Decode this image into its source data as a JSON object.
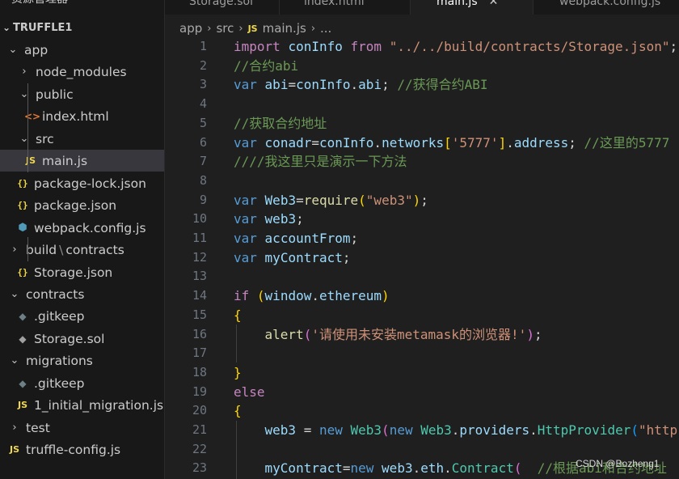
{
  "sidebar": {
    "title": "资源管理器",
    "project": "TRUFFLE1",
    "items": [
      {
        "label": "app",
        "kind": "folder-open"
      },
      {
        "label": "node_modules",
        "kind": "folder-closed"
      },
      {
        "label": "public",
        "kind": "folder-open"
      },
      {
        "label": "index.html",
        "kind": "html"
      },
      {
        "label": "src",
        "kind": "folder-open"
      },
      {
        "label": "main.js",
        "kind": "js"
      },
      {
        "label": "package-lock.json",
        "kind": "json"
      },
      {
        "label": "package.json",
        "kind": "json"
      },
      {
        "label": "webpack.config.js",
        "kind": "webpack"
      },
      {
        "label": "build",
        "label2": "contracts",
        "kind": "folder-closed"
      },
      {
        "label": "Storage.json",
        "kind": "json"
      },
      {
        "label": "contracts",
        "kind": "folder-open"
      },
      {
        "label": ".gitkeep",
        "kind": "git"
      },
      {
        "label": "Storage.sol",
        "kind": "sol"
      },
      {
        "label": "migrations",
        "kind": "folder-open"
      },
      {
        "label": ".gitkeep",
        "kind": "git"
      },
      {
        "label": "1_initial_migration.js",
        "kind": "js"
      },
      {
        "label": "test",
        "kind": "folder-closed"
      },
      {
        "label": "truffle-config.js",
        "kind": "js"
      }
    ]
  },
  "tabs": [
    {
      "label": "Storage.sol"
    },
    {
      "label": "index.html"
    },
    {
      "label": "main.js",
      "active": true,
      "close": "✕"
    },
    {
      "label": "webpack.config.js"
    }
  ],
  "breadcrumb": {
    "parts": [
      "app",
      "src"
    ],
    "file": "main.js",
    "tail": "..."
  },
  "editor": {
    "lines": [
      {
        "n": "1",
        "t": [
          [
            "kw2",
            "import"
          ],
          [
            "pl",
            " "
          ],
          [
            "vr",
            "conInfo"
          ],
          [
            "pl",
            " "
          ],
          [
            "kw2",
            "from"
          ],
          [
            "pl",
            " "
          ],
          [
            "str",
            "\"../../build/contracts/Storage.json\""
          ],
          [
            "pl",
            ";"
          ]
        ]
      },
      {
        "n": "2",
        "t": [
          [
            "cm",
            "//合约abi"
          ]
        ]
      },
      {
        "n": "3",
        "t": [
          [
            "kw",
            "var"
          ],
          [
            "pl",
            " "
          ],
          [
            "vr",
            "abi"
          ],
          [
            "pl",
            "="
          ],
          [
            "vr",
            "conInfo"
          ],
          [
            "pl",
            "."
          ],
          [
            "vr",
            "abi"
          ],
          [
            "pl",
            "; "
          ],
          [
            "cm",
            "//获得合约ABI"
          ]
        ]
      },
      {
        "n": "4",
        "t": []
      },
      {
        "n": "5",
        "t": [
          [
            "cm",
            "//获取合约地址"
          ]
        ]
      },
      {
        "n": "6",
        "t": [
          [
            "kw",
            "var"
          ],
          [
            "pl",
            " "
          ],
          [
            "vr",
            "conadr"
          ],
          [
            "pl",
            "="
          ],
          [
            "vr",
            "conInfo"
          ],
          [
            "pl",
            "."
          ],
          [
            "vr",
            "networks"
          ],
          [
            "br1",
            "["
          ],
          [
            "str",
            "'5777'"
          ],
          [
            "br1",
            "]"
          ],
          [
            "pl",
            "."
          ],
          [
            "vr",
            "address"
          ],
          [
            "pl",
            "; "
          ],
          [
            "cm",
            "//这里的5777"
          ]
        ]
      },
      {
        "n": "7",
        "t": [
          [
            "cm",
            "////我这里只是演示一下方法"
          ]
        ]
      },
      {
        "n": "8",
        "t": []
      },
      {
        "n": "9",
        "t": [
          [
            "kw",
            "var"
          ],
          [
            "pl",
            " "
          ],
          [
            "vr",
            "Web3"
          ],
          [
            "pl",
            "="
          ],
          [
            "fn",
            "require"
          ],
          [
            "br1",
            "("
          ],
          [
            "str",
            "\"web3\""
          ],
          [
            "br1",
            ")"
          ],
          [
            "pl",
            ";"
          ]
        ]
      },
      {
        "n": "10",
        "t": [
          [
            "kw",
            "var"
          ],
          [
            "pl",
            " "
          ],
          [
            "vr",
            "web3"
          ],
          [
            "pl",
            ";"
          ]
        ]
      },
      {
        "n": "11",
        "t": [
          [
            "kw",
            "var"
          ],
          [
            "pl",
            " "
          ],
          [
            "vr",
            "accountFrom"
          ],
          [
            "pl",
            ";"
          ]
        ]
      },
      {
        "n": "12",
        "t": [
          [
            "kw",
            "var"
          ],
          [
            "pl",
            " "
          ],
          [
            "vr",
            "myContract"
          ],
          [
            "pl",
            ";"
          ]
        ]
      },
      {
        "n": "13",
        "t": []
      },
      {
        "n": "14",
        "t": [
          [
            "kw2",
            "if"
          ],
          [
            "pl",
            " "
          ],
          [
            "br1",
            "("
          ],
          [
            "vr",
            "window"
          ],
          [
            "pl",
            "."
          ],
          [
            "vr",
            "ethereum"
          ],
          [
            "br1",
            ")"
          ]
        ]
      },
      {
        "n": "15",
        "t": [
          [
            "br1",
            "{"
          ]
        ]
      },
      {
        "n": "16",
        "t": [
          [
            "pl",
            "    "
          ],
          [
            "fn",
            "alert"
          ],
          [
            "br2",
            "("
          ],
          [
            "str",
            "'请使用未安装metamask的浏览器!'"
          ],
          [
            "br2",
            ")"
          ],
          [
            "pl",
            ";"
          ]
        ]
      },
      {
        "n": "17",
        "t": []
      },
      {
        "n": "18",
        "t": [
          [
            "br1",
            "}"
          ]
        ]
      },
      {
        "n": "19",
        "t": [
          [
            "kw2",
            "else"
          ]
        ]
      },
      {
        "n": "20",
        "t": [
          [
            "br1",
            "{"
          ]
        ]
      },
      {
        "n": "21",
        "t": [
          [
            "pl",
            "    "
          ],
          [
            "vr",
            "web3"
          ],
          [
            "pl",
            " = "
          ],
          [
            "kw",
            "new"
          ],
          [
            "pl",
            " "
          ],
          [
            "cl",
            "Web3"
          ],
          [
            "br2",
            "("
          ],
          [
            "kw",
            "new"
          ],
          [
            "pl",
            " "
          ],
          [
            "cl",
            "Web3"
          ],
          [
            "pl",
            "."
          ],
          [
            "vr",
            "providers"
          ],
          [
            "pl",
            "."
          ],
          [
            "cl",
            "HttpProvider"
          ],
          [
            "br3",
            "("
          ],
          [
            "str",
            "\"http"
          ]
        ]
      },
      {
        "n": "22",
        "t": []
      },
      {
        "n": "23",
        "t": [
          [
            "pl",
            "    "
          ],
          [
            "vr",
            "myContract"
          ],
          [
            "pl",
            "="
          ],
          [
            "kw",
            "new"
          ],
          [
            "pl",
            " "
          ],
          [
            "vr",
            "web3"
          ],
          [
            "pl",
            "."
          ],
          [
            "vr",
            "eth"
          ],
          [
            "pl",
            "."
          ],
          [
            "cl",
            "Contract"
          ],
          [
            "br2",
            "("
          ],
          [
            "pl",
            "  "
          ],
          [
            "cm",
            "//根据abi和合约地址"
          ]
        ]
      }
    ]
  },
  "watermark": "CSDN @Bozheng1"
}
